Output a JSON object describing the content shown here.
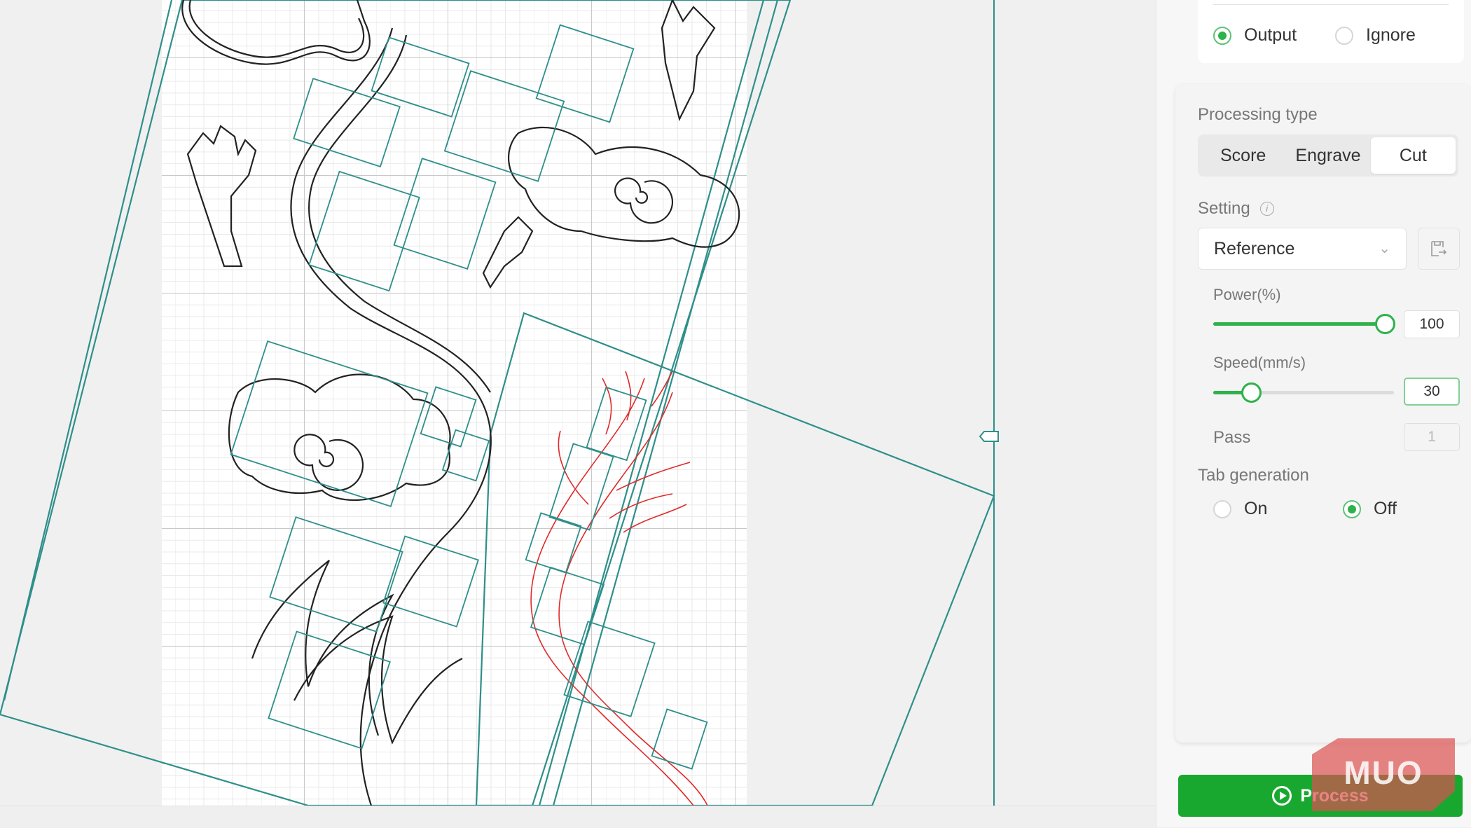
{
  "output_mode": {
    "options": [
      "Output",
      "Ignore"
    ],
    "selected": "Output"
  },
  "processing_type": {
    "label": "Processing type",
    "options": [
      "Score",
      "Engrave",
      "Cut"
    ],
    "selected": "Cut"
  },
  "setting": {
    "label": "Setting",
    "info_icon": "info-icon",
    "value": "Reference",
    "save_icon": "save-preset-icon"
  },
  "power": {
    "label": "Power(%)",
    "value": "100",
    "fraction": 1.0
  },
  "speed": {
    "label": "Speed(mm/s)",
    "value": "30",
    "fraction": 0.21
  },
  "pass": {
    "label": "Pass",
    "value": "1"
  },
  "tab_generation": {
    "label": "Tab generation",
    "options": [
      "On",
      "Off"
    ],
    "selected": "Off"
  },
  "process_button": {
    "label": "Process",
    "icon": "play-circle-icon"
  },
  "watermark": {
    "text": "MUO"
  },
  "colors": {
    "accent": "#2fb24c",
    "process_button": "#18a82f",
    "selection_box": "#2e8f8a",
    "cut_path": "#e02a2a",
    "score_path": "#222222"
  }
}
